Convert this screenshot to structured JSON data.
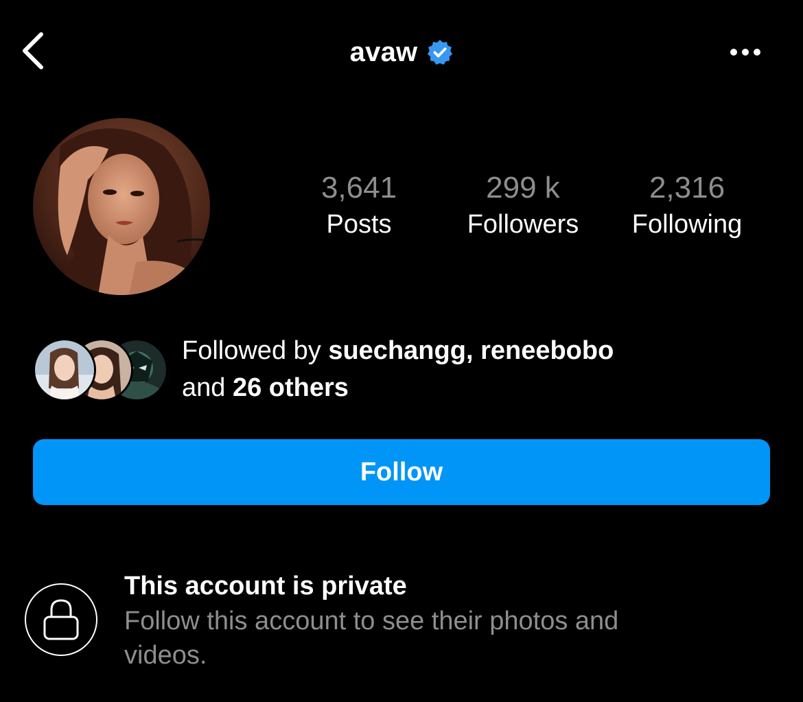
{
  "header": {
    "username": "avaw",
    "verified": true,
    "back_icon": "chevron-left-icon",
    "more_icon": "ellipsis-icon"
  },
  "stats": [
    {
      "value": "3,641",
      "label": "Posts"
    },
    {
      "value": "299 k",
      "label": "Followers"
    },
    {
      "value": "2,316",
      "label": "Following"
    }
  ],
  "followed_by": {
    "prefix": "Followed by ",
    "user1": "suechangg",
    "separator": ", ",
    "user2": "reneebobo",
    "line2_prefix": "and ",
    "others": "26 others"
  },
  "follow_button": {
    "label": "Follow"
  },
  "private_notice": {
    "title": "This account is private",
    "description": "Follow this account to see their photos and videos."
  },
  "colors": {
    "background": "#000000",
    "accent": "#0095f6",
    "verified_badge": "#3897f0",
    "secondary_text": "#8e8e8e"
  }
}
